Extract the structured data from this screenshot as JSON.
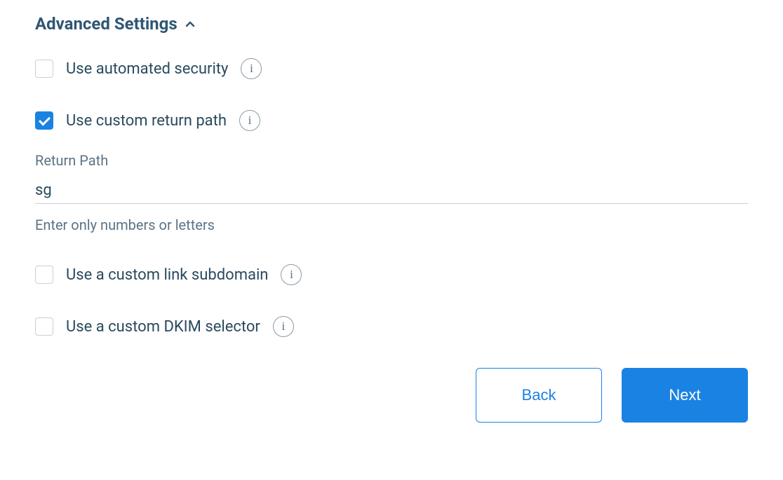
{
  "section": {
    "title": "Advanced Settings"
  },
  "options": {
    "automated_security": {
      "label": "Use automated security",
      "checked": false
    },
    "custom_return_path": {
      "label": "Use custom return path",
      "checked": true
    },
    "custom_link_subdomain": {
      "label": "Use a custom link subdomain",
      "checked": false
    },
    "custom_dkim_selector": {
      "label": "Use a custom DKIM selector",
      "checked": false
    }
  },
  "return_path": {
    "label": "Return Path",
    "value": "sg",
    "helper": "Enter only numbers or letters"
  },
  "buttons": {
    "back": "Back",
    "next": "Next"
  }
}
